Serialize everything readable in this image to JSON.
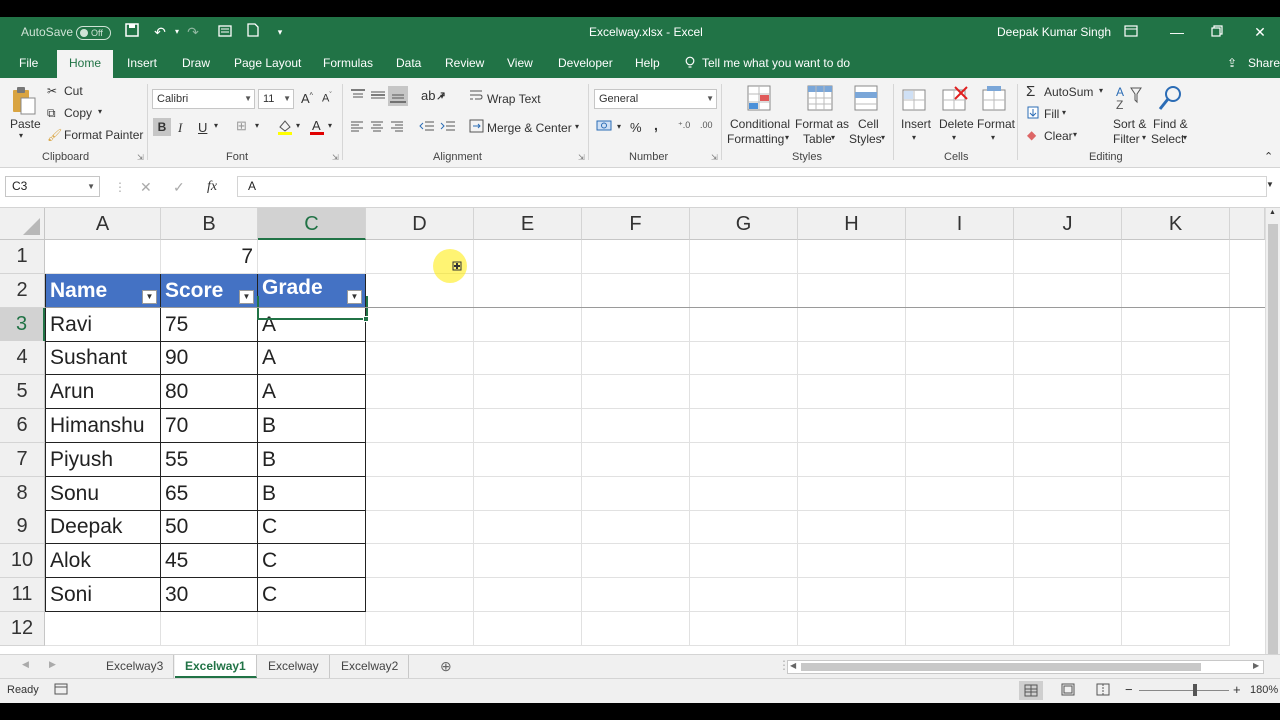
{
  "window": {
    "filename_title": "Excelway.xlsx - Excel",
    "user": "Deepak Kumar Singh",
    "autosave_label": "AutoSave",
    "autosave_state": "Off"
  },
  "tabs": [
    "File",
    "Home",
    "Insert",
    "Draw",
    "Page Layout",
    "Formulas",
    "Data",
    "Review",
    "View",
    "Developer",
    "Help"
  ],
  "tell_me": "Tell me what you want to do",
  "share": "Share",
  "ribbon": {
    "clipboard": {
      "paste": "Paste",
      "cut": "Cut",
      "copy": "Copy",
      "format_painter": "Format Painter",
      "label": "Clipboard"
    },
    "font": {
      "name": "Calibri",
      "size": "11",
      "label": "Font",
      "bold": "B",
      "italic": "I",
      "underline": "U"
    },
    "alignment": {
      "wrap_text": "Wrap Text",
      "merge_center": "Merge & Center",
      "label": "Alignment"
    },
    "number": {
      "format": "General",
      "percent": "%",
      "comma": ",",
      "label": "Number"
    },
    "styles": {
      "conditional_1": "Conditional",
      "conditional_2": "Formatting",
      "format_table_1": "Format as",
      "format_table_2": "Table",
      "cell_styles_1": "Cell",
      "cell_styles_2": "Styles",
      "label": "Styles"
    },
    "cells": {
      "insert": "Insert",
      "delete": "Delete",
      "format": "Format",
      "label": "Cells"
    },
    "editing": {
      "autosum": "AutoSum",
      "fill": "Fill",
      "clear": "Clear",
      "sort_1": "Sort &",
      "sort_2": "Filter",
      "find_1": "Find &",
      "find_2": "Select",
      "label": "Editing"
    }
  },
  "formula_bar": {
    "name_box": "C3",
    "fx": "fx",
    "content": "A"
  },
  "columns": [
    "A",
    "B",
    "C",
    "D",
    "E",
    "F",
    "G",
    "H",
    "I",
    "J",
    "K"
  ],
  "rows": [
    "1",
    "2",
    "3",
    "4",
    "5",
    "6",
    "7",
    "8",
    "9",
    "10",
    "11",
    "12"
  ],
  "sheet": {
    "b1": "7",
    "headers": [
      "Name",
      "Score",
      "Grade"
    ],
    "data": [
      [
        "Ravi",
        "75",
        "A"
      ],
      [
        "Sushant",
        "90",
        "A"
      ],
      [
        "Arun",
        "80",
        "A"
      ],
      [
        "Himanshu",
        "70",
        "B"
      ],
      [
        "Piyush",
        "55",
        "B"
      ],
      [
        "Sonu",
        "65",
        "B"
      ],
      [
        "Deepak",
        "50",
        "C"
      ],
      [
        "Alok",
        "45",
        "C"
      ],
      [
        "Soni",
        "30",
        "C"
      ]
    ]
  },
  "sheet_tabs": [
    "Excelway3",
    "Excelway1",
    "Excelway",
    "Excelway2"
  ],
  "active_sheet": "Excelway1",
  "status": {
    "ready": "Ready",
    "zoom": "180%"
  },
  "colors": {
    "excel_green": "#217346",
    "table_header": "#4472c4"
  }
}
